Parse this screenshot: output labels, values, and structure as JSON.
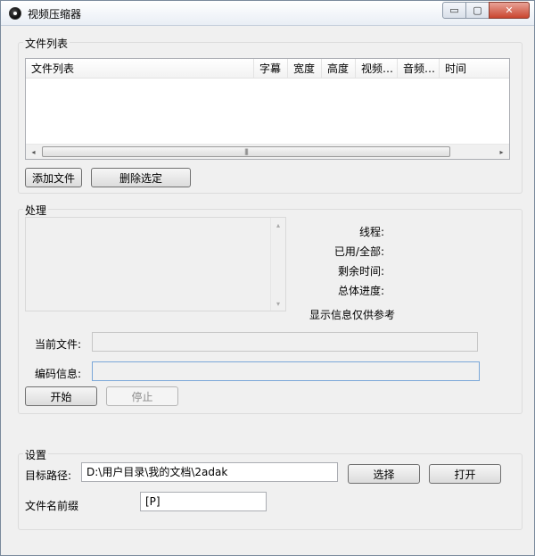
{
  "window": {
    "title": "视频压缩器",
    "minimize_glyph": "▭",
    "maximize_glyph": "▢",
    "close_glyph": "✕"
  },
  "file_list": {
    "group_label": "文件列表",
    "columns": [
      "文件列表",
      "字幕",
      "宽度",
      "高度",
      "视频…",
      "音频…",
      "时间"
    ],
    "scroll_left": "◂",
    "scroll_right": "▸",
    "thumb_grip": "|||",
    "add_button": "添加文件",
    "delete_button": "删除选定"
  },
  "processing": {
    "group_label": "处理",
    "scroll_up": "▴",
    "scroll_down": "▾",
    "threads_label": "线程:",
    "used_total_label": "已用/全部:",
    "remaining_label": "剩余时间:",
    "overall_label": "总体进度:",
    "note": "显示信息仅供参考",
    "current_file_label": "当前文件:",
    "encode_info_label": "编码信息:",
    "start_button": "开始",
    "stop_button": "停止"
  },
  "settings": {
    "group_label": "设置",
    "target_path_label": "目标路径:",
    "target_path_value": "D:\\用户目录\\我的文档\\2adak",
    "choose_button": "选择",
    "open_button": "打开",
    "prefix_label": "文件名前缀",
    "prefix_value": "[P]"
  }
}
